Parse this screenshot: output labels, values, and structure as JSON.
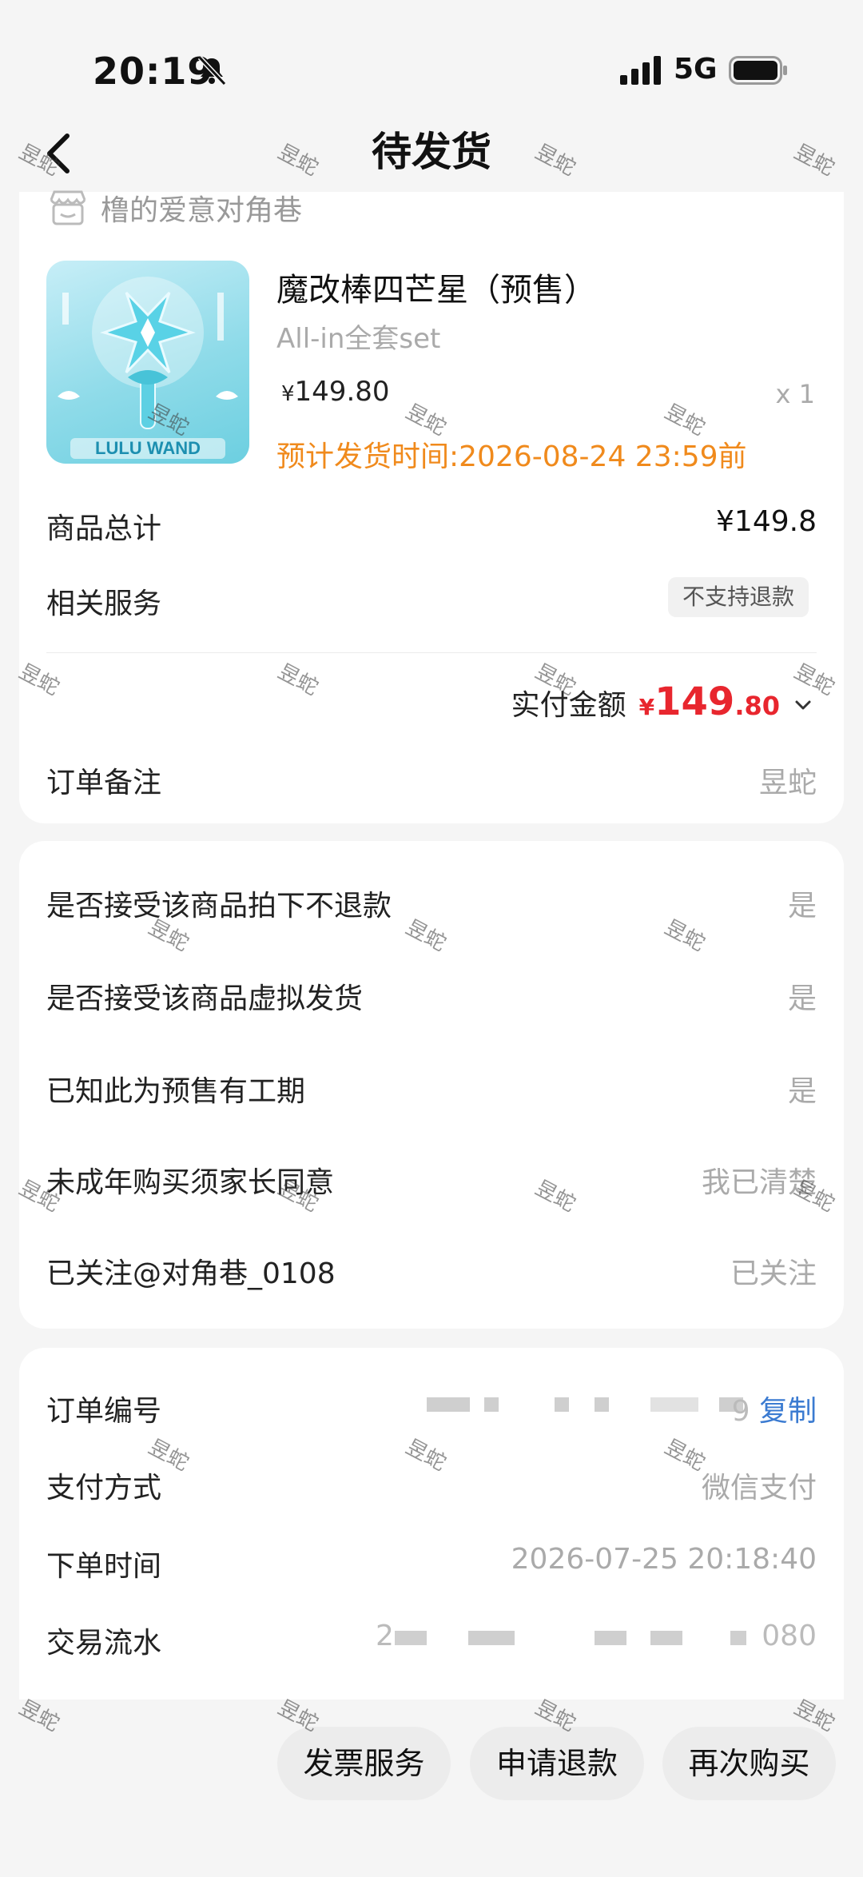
{
  "status_bar": {
    "time": "20:19",
    "network": "5G"
  },
  "nav": {
    "title": "待发货"
  },
  "shop": {
    "name": "橹的爱意对角巷"
  },
  "product": {
    "title": "魔改棒四芒星（预售）",
    "spec": "All-in全套set",
    "price_symbol": "¥",
    "price": "149.80",
    "quantity": "x 1",
    "ship_time": "预计发货时间:2026-08-24 23:59前",
    "image_text": "LULU WAND"
  },
  "summary": {
    "goods_total_label": "商品总计",
    "goods_total_value": "¥149.8",
    "service_label": "相关服务",
    "service_tag": "不支持退款",
    "paid_label": "实付金额",
    "paid_symbol": "¥",
    "paid_int": "149",
    "paid_dec": ".80",
    "remark_label": "订单备注",
    "remark_value": "昱蛇"
  },
  "questions": [
    {
      "label": "是否接受该商品拍下不退款",
      "value": "是"
    },
    {
      "label": "是否接受该商品虚拟发货",
      "value": "是"
    },
    {
      "label": "已知此为预售有工期",
      "value": "是"
    },
    {
      "label": "未成年购买须家长同意",
      "value": "我已清楚"
    },
    {
      "label": "已关注@对角巷_0108",
      "value": "已关注"
    }
  ],
  "order_info": {
    "order_no_label": "订单编号",
    "order_no_tail": "9",
    "copy_label": "复制",
    "pay_method_label": "支付方式",
    "pay_method_value": "微信支付",
    "order_time_label": "下单时间",
    "order_time_value": "2026-07-25 20:18:40",
    "txn_label": "交易流水",
    "txn_head": "2",
    "txn_tail": "080"
  },
  "actions": {
    "invoice": "发票服务",
    "refund": "申请退款",
    "rebuy": "再次购买"
  },
  "watermark": "昱蛇"
}
